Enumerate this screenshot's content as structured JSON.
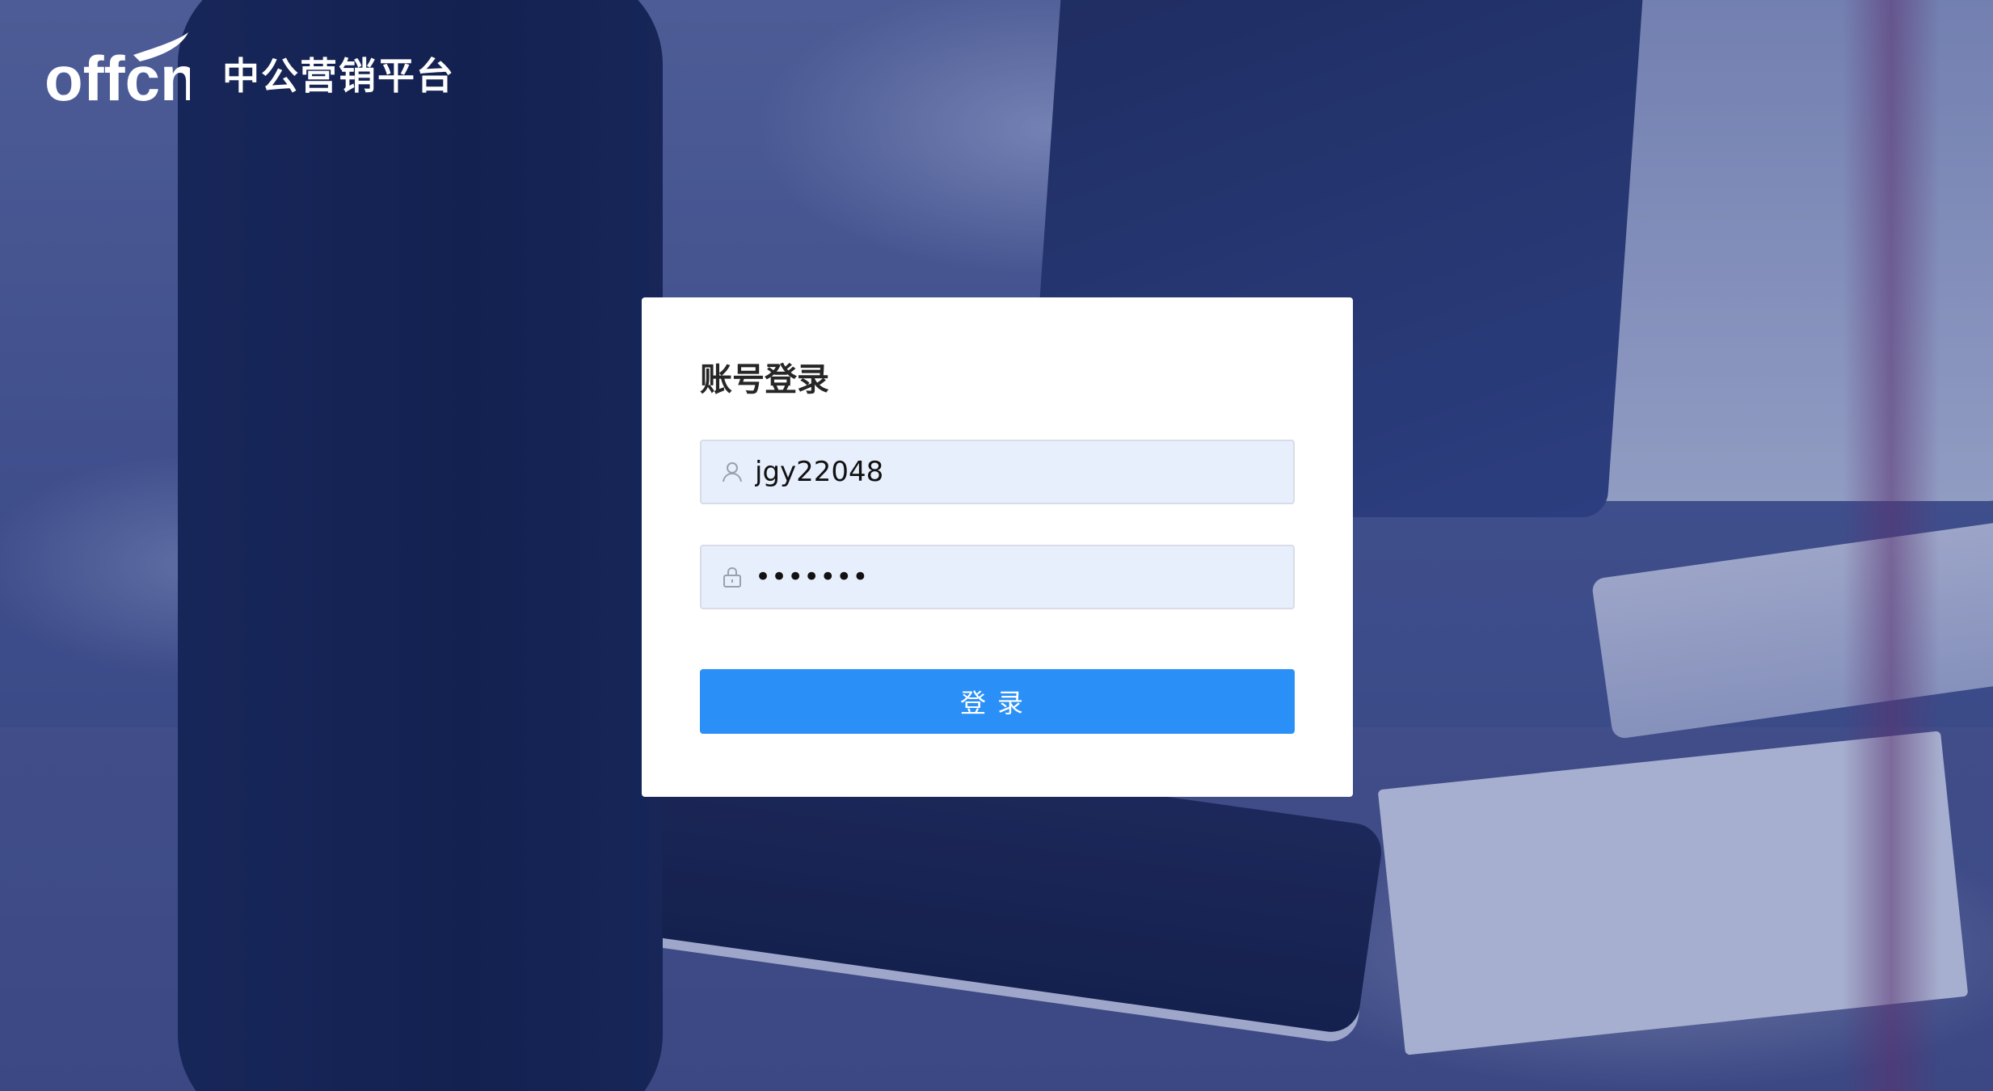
{
  "brand": {
    "logo_text": "offcn",
    "title": "中公营销平台"
  },
  "login": {
    "title": "账号登录",
    "username": {
      "value": "jgy22048",
      "icon": "user-icon"
    },
    "password": {
      "value": "•••••••",
      "icon": "lock-icon"
    },
    "submit_label": "登录"
  },
  "colors": {
    "primary_button": "#2a90f8",
    "input_bg": "#e8effc",
    "card_bg": "#ffffff",
    "overlay": "#1e3278"
  }
}
